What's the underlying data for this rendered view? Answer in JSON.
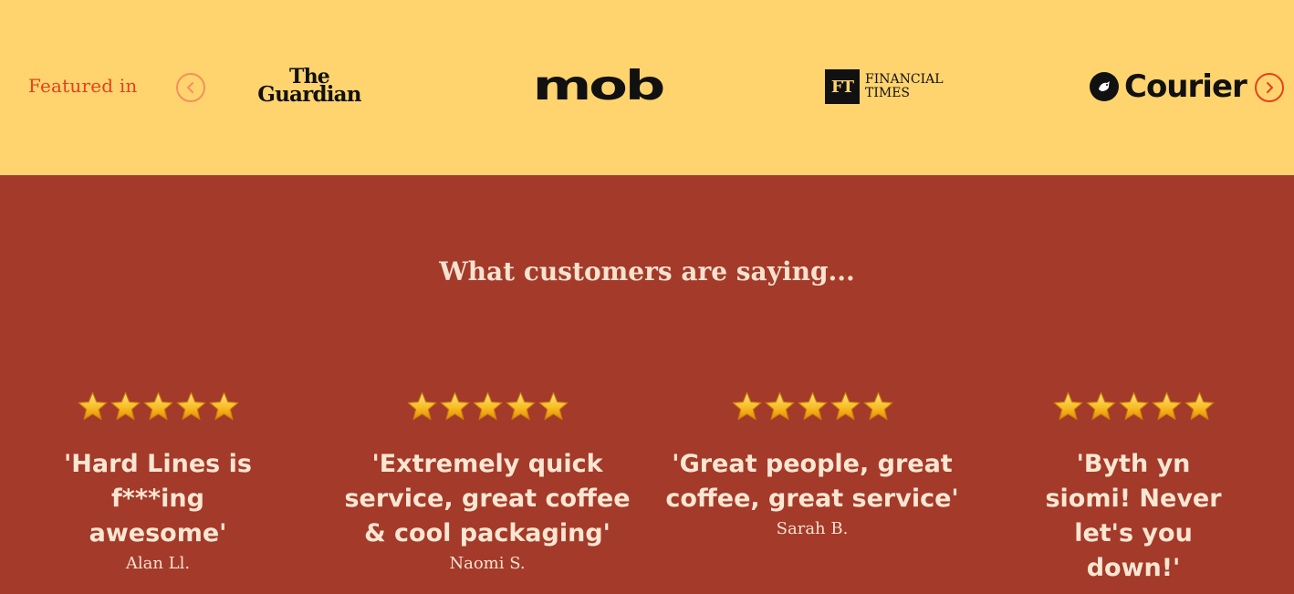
{
  "press": {
    "featured_label": "Featured in",
    "logos": {
      "guardian_line1": "The",
      "guardian_line2": "Guardian",
      "mob": "mob",
      "ft_mark": "FT",
      "ft_line1": "FINANCIAL",
      "ft_line2": "TIMES",
      "courier": "Courier"
    },
    "prev_icon": "chevron-left-icon",
    "next_icon": "chevron-right-icon"
  },
  "reviews": {
    "title": "What customers are saying...",
    "items": [
      {
        "rating": 5,
        "quote": "'Hard Lines is f***ing awesome'",
        "author": "Alan Ll."
      },
      {
        "rating": 5,
        "quote": "'Extremely quick service, great coffee & cool packaging'",
        "author": "Naomi S."
      },
      {
        "rating": 5,
        "quote": "'Great people, great coffee, great service'",
        "author": "Sarah B."
      },
      {
        "rating": 5,
        "quote": "'Byth yn siomi! Never let's you down!'",
        "author": ""
      }
    ]
  },
  "colors": {
    "press_bg": "#ffd46e",
    "reviews_bg": "#a33a2a",
    "accent": "#e8401c",
    "text_light": "#f6e2cf"
  }
}
